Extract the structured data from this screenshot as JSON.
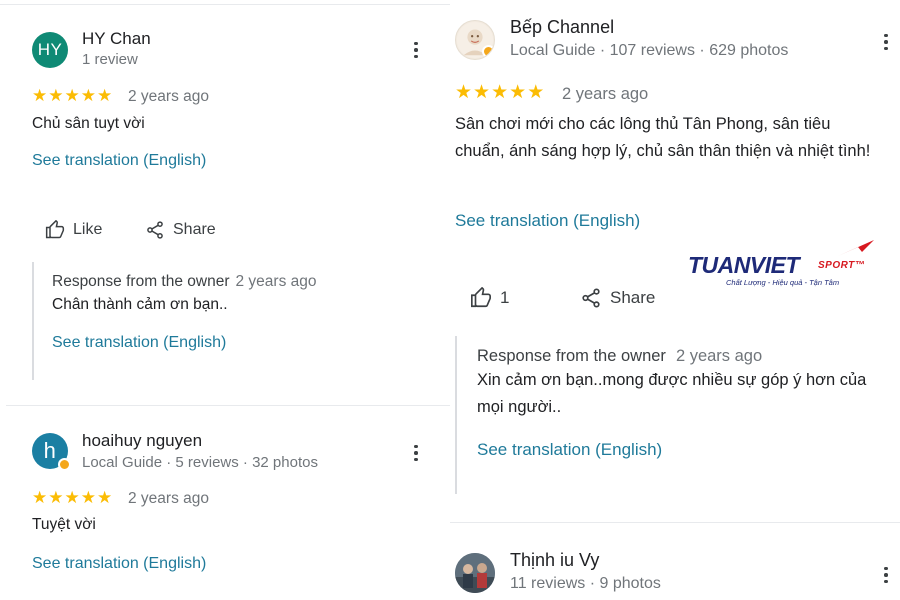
{
  "left_column": {
    "review1": {
      "avatar_initials": "HY",
      "author": "HY Chan",
      "meta": "1 review",
      "rating": 5,
      "time": "2 years ago",
      "text": "Chủ sân tuyt vời",
      "translate": "See translation (English)",
      "like_label": "Like",
      "share_label": "Share",
      "owner_response": {
        "label": "Response from the owner",
        "time": "2 years ago",
        "text": "Chân thành cảm ơn bạn..",
        "translate": "See translation (English)"
      }
    },
    "review2": {
      "avatar_initials": "h",
      "author": "hoaihuy nguyen",
      "meta": "Local Guide · 5 reviews · 32 photos",
      "rating": 5,
      "time": "2 years ago",
      "text": "Tuyệt vời",
      "translate": "See translation (English)"
    }
  },
  "right_column": {
    "review1": {
      "author": "Bếp Channel",
      "meta": "Local Guide · 107 reviews · 629 photos",
      "rating": 5,
      "time": "2 years ago",
      "text": "Sân chơi mới cho các lông thủ Tân Phong, sân tiêu chuẩn, ánh sáng hợp lý, chủ sân thân thiện và nhiệt tình!",
      "translate": "See translation (English)",
      "like_count": "1",
      "share_label": "Share",
      "owner_response": {
        "label": "Response from the owner",
        "time": "2 years ago",
        "text": "Xin cảm ơn bạn..mong được nhiều sự góp ý hơn của mọi người..",
        "translate": "See translation (English)"
      }
    },
    "review2": {
      "author": "Thịnh iu Vy",
      "meta": "11 reviews · 9 photos"
    }
  },
  "watermark": {
    "brand": "TUANVIET",
    "brand_suffix": "SPORT™",
    "tagline": "Chất Lượng - Hiệu quả - Tận Tâm"
  },
  "colors": {
    "star": "#fbbc04",
    "link": "#1f7a9a",
    "avatar_hy": "#0f8a75",
    "avatar_h": "#1b7fa3",
    "logo_blue": "#1e2a78",
    "logo_red": "#d71920"
  }
}
